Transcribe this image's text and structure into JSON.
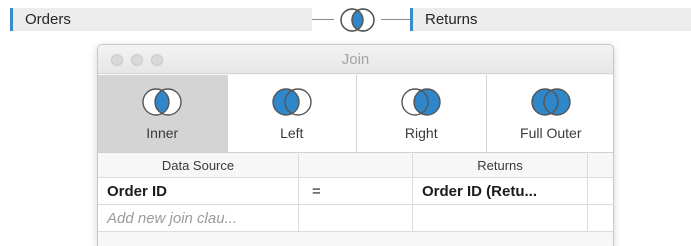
{
  "canvas": {
    "left_table": "Orders",
    "right_table": "Returns",
    "link_icon": "inner-join-icon"
  },
  "dialog": {
    "title": "Join",
    "join_types": [
      {
        "label": "Inner",
        "icon": "inner-join-icon",
        "selected": true
      },
      {
        "label": "Left",
        "icon": "left-join-icon",
        "selected": false
      },
      {
        "label": "Right",
        "icon": "right-join-icon",
        "selected": false
      },
      {
        "label": "Full Outer",
        "icon": "full-outer-join-icon",
        "selected": false
      }
    ],
    "grid": {
      "headers": {
        "left": "Data Source",
        "operator": "",
        "right": "Returns"
      },
      "clauses": [
        {
          "left": "Order ID",
          "operator": "=",
          "right": "Order ID (Retu..."
        }
      ],
      "add_placeholder": "Add new join clau..."
    }
  },
  "colors": {
    "accent_blue": "#2f86c9",
    "selected_bg": "#d4d4d4",
    "pill_bg": "#ececec"
  }
}
